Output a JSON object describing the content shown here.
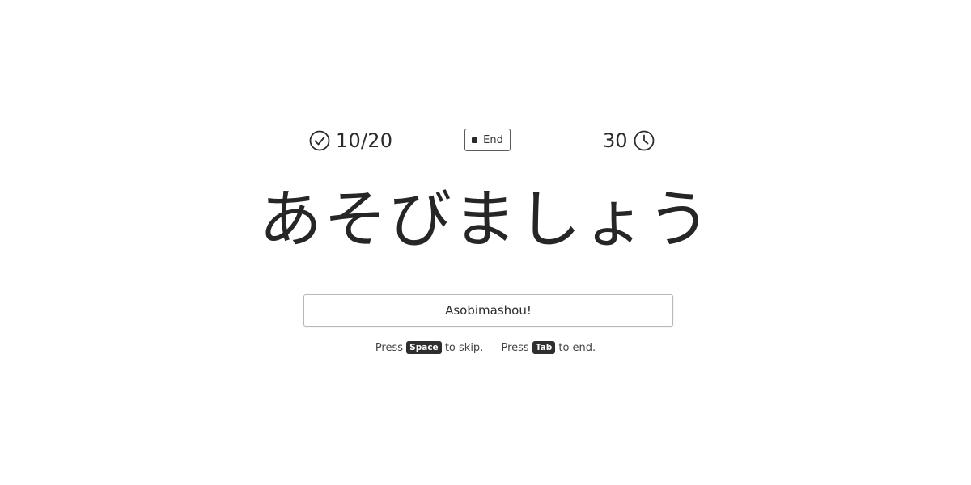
{
  "status": {
    "score": "10/20",
    "end_label": "End",
    "timer": "30"
  },
  "prompt": {
    "word": "あそびましょう"
  },
  "answer": {
    "value": "Asobimashou!"
  },
  "hints": {
    "skip_prefix": "Press",
    "skip_key": "Space",
    "skip_suffix": "to skip.",
    "end_prefix": "Press",
    "end_key": "Tab",
    "end_suffix": "to end."
  },
  "icons": {
    "score": "check-circle-icon",
    "end": "stop-icon",
    "timer": "clock-icon"
  },
  "colors": {
    "text": "#2b2b2b",
    "key_background": "#2e2e2e",
    "background": "#ffffff"
  }
}
